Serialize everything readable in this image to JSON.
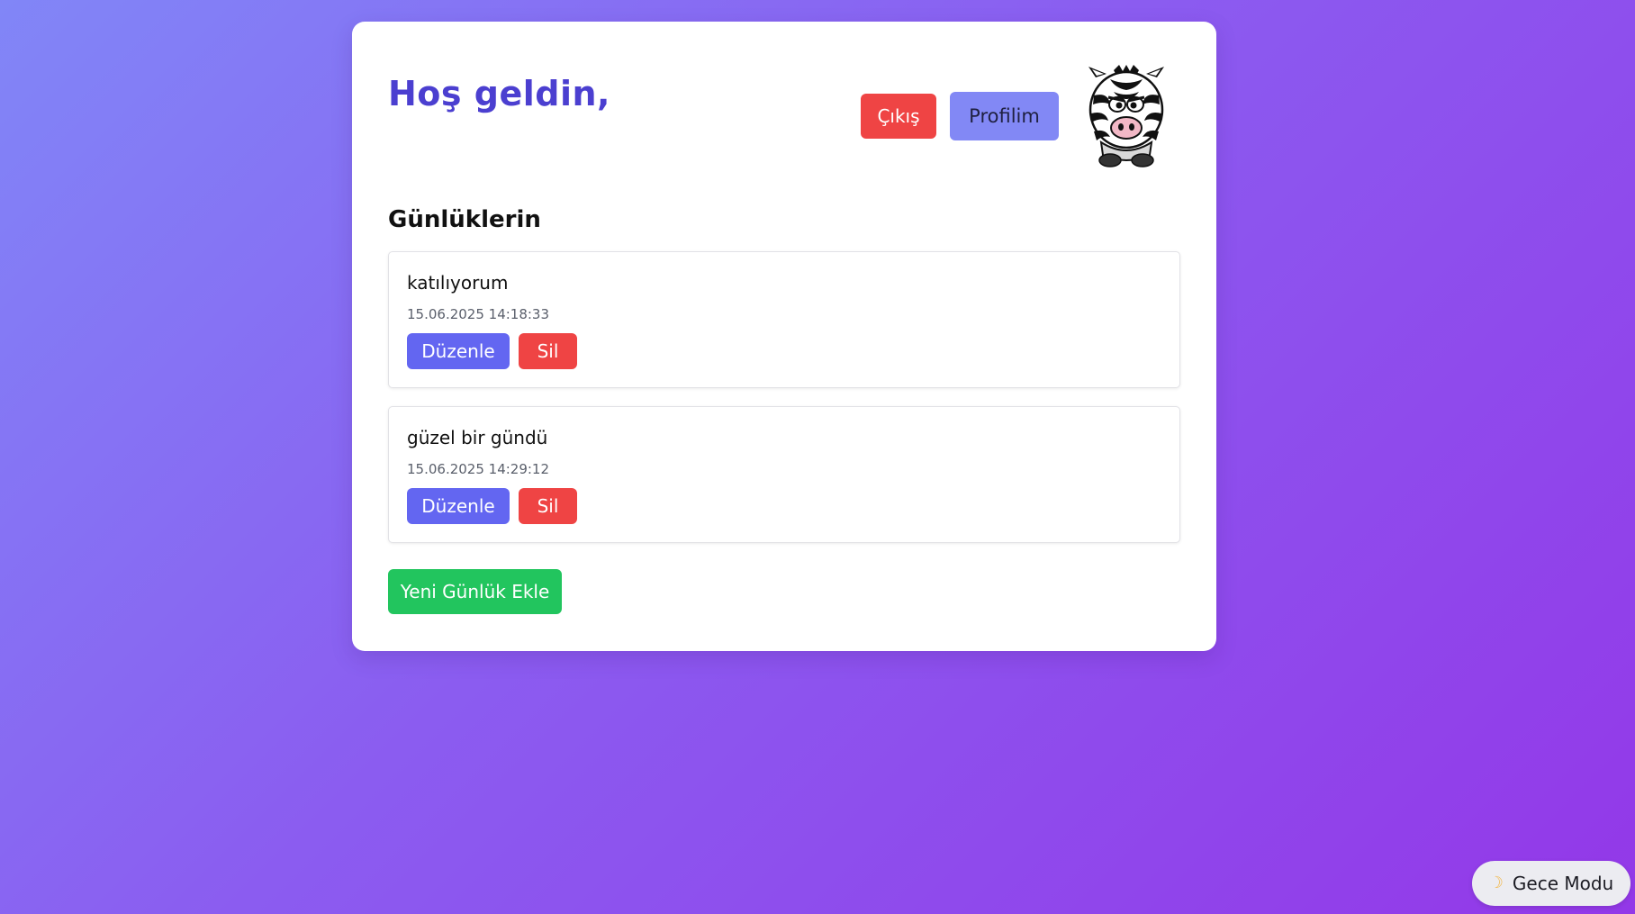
{
  "header": {
    "welcome": "Hoş geldin,",
    "logout_label": "Çıkış",
    "profile_label": "Profilim",
    "avatar_icon": "zebra-avatar-icon"
  },
  "diary": {
    "title": "Günlüklerin",
    "entries": [
      {
        "text": "katılıyorum",
        "date": "15.06.2025 14:18:33",
        "edit_label": "Düzenle",
        "delete_label": "Sil"
      },
      {
        "text": "güzel bir gündü",
        "date": "15.06.2025 14:29:12",
        "edit_label": "Düzenle",
        "delete_label": "Sil"
      }
    ],
    "add_label": "Yeni Günlük Ekle"
  },
  "theme_toggle": {
    "icon": "moon-icon",
    "label": "Gece Modu"
  },
  "colors": {
    "accent": "#6366f1",
    "danger": "#ef4444",
    "success": "#22c55e",
    "heading": "#4b3fd0"
  }
}
